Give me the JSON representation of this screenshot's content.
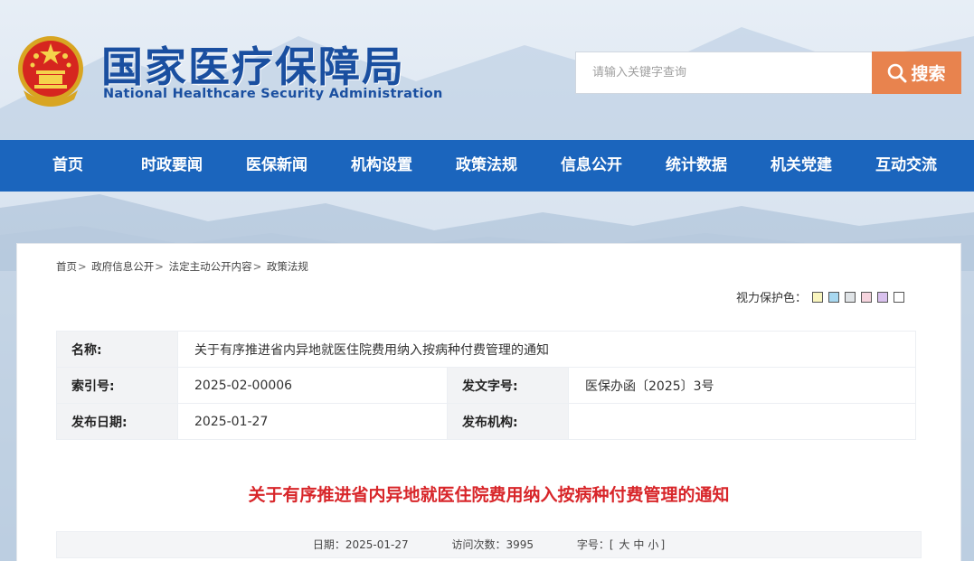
{
  "site": {
    "title": "国家医疗保障局",
    "subtitle": "National Healthcare Security Administration"
  },
  "search": {
    "placeholder": "请输入关键字查询",
    "button_label": "搜索"
  },
  "nav": {
    "items": [
      "首页",
      "时政要闻",
      "医保新闻",
      "机构设置",
      "政策法规",
      "信息公开",
      "统计数据",
      "机关党建",
      "互动交流"
    ]
  },
  "breadcrumb": [
    "首页",
    "政府信息公开",
    "法定主动公开内容",
    "政策法规"
  ],
  "vision": {
    "label": "视力保护色：",
    "swatches": [
      "#f9f5be",
      "#a8d8f0",
      "#dfe3e6",
      "#f6d4de",
      "#d9c1ee",
      "#ffffff"
    ]
  },
  "info": {
    "name_label": "名称:",
    "name_value": "关于有序推进省内异地就医住院费用纳入按病种付费管理的通知",
    "index_label": "索引号:",
    "index_value": "2025-02-00006",
    "docno_label": "发文字号:",
    "docno_value": "医保办函〔2025〕3号",
    "date_label": "发布日期:",
    "date_value": "2025-01-27",
    "org_label": "发布机构:",
    "org_value": ""
  },
  "document": {
    "title": "关于有序推进省内异地就医住院费用纳入按病种付费管理的通知"
  },
  "meta": {
    "date_label": "日期：",
    "date_value": "2025-01-27",
    "visits_label": "访问次数：",
    "visits_value": "3995",
    "fontsize_label": "字号：",
    "fontsize_open": "[",
    "fontsize_large": "大",
    "fontsize_medium": "中",
    "fontsize_small": "小",
    "fontsize_close": "]"
  }
}
